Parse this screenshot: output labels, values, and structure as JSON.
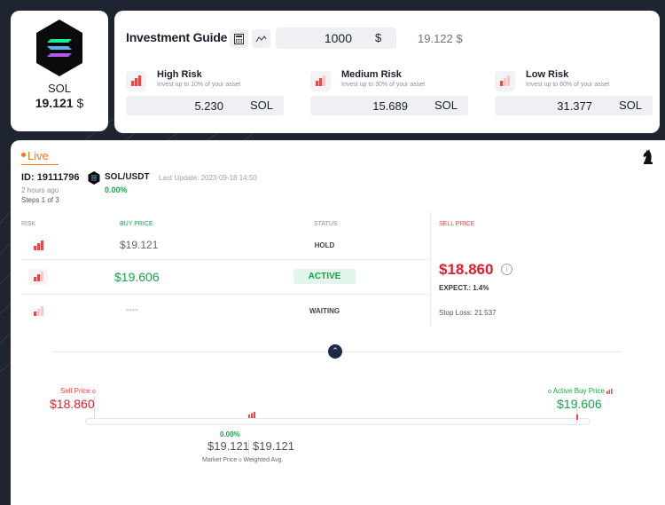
{
  "coin": {
    "name": "SOL",
    "price": "19.121",
    "currency_symbol": "$"
  },
  "guide": {
    "title": "Investment Guide",
    "calculator_icon": "calculator-icon",
    "chart_icon": "chart-line-icon",
    "amount_value": "1000",
    "amount_currency": "$",
    "converted_value": "19.122 $",
    "risks": [
      {
        "title": "High Risk",
        "desc": "Invest up to 10% of your asset",
        "value": "5.230",
        "unit": "SOL",
        "color": "#ef4444",
        "level": "high"
      },
      {
        "title": "Medium Risk",
        "desc": "Invest up to 30% of your asset",
        "value": "15.689",
        "unit": "SOL",
        "color": "#ef4444",
        "level": "medium"
      },
      {
        "title": "Low Risk",
        "desc": "Invest up to 60% of your asset",
        "value": "31.377",
        "unit": "SOL",
        "color": "#ef4444",
        "level": "low"
      }
    ]
  },
  "position": {
    "live_label": "Live",
    "id_label": "ID: 19111796",
    "time_ago": "2 hours ago",
    "steps": "Steps 1 of 3",
    "pair": "SOL/USDT",
    "pair_change": "0.00%",
    "last_update": "Last Update: 2023-09-18 14:50",
    "headers": {
      "risk": "RISK",
      "buy_price": "BUY PRICE",
      "status": "STATUS",
      "sell_price": "SELL PRICE"
    },
    "rows": [
      {
        "level": "high",
        "buy_price": "$19.121",
        "status": "HOLD"
      },
      {
        "level": "medium",
        "buy_price": "$19.606",
        "status": "ACTIVE"
      },
      {
        "level": "low",
        "buy_price": "----",
        "status": "WAITING"
      }
    ],
    "sell_price": "$18.860",
    "expect": "EXPECT.: 1.4%",
    "stop_loss": "Stop Loss: 21.537"
  },
  "range": {
    "sell_label": "Sell Price",
    "sell_value": "$18.860",
    "active_label": "Active Buy Price",
    "active_value": "$19.606",
    "market_change": "0.00%",
    "market_price": "$19.121",
    "weighted_avg": "$19.121",
    "market_label": "Market Price",
    "weighted_label": "Weighted Avg."
  },
  "colors": {
    "accent_green": "#16a34a",
    "accent_red": "#e11d2a",
    "live_orange": "#f97316",
    "background": "#1f2530"
  }
}
